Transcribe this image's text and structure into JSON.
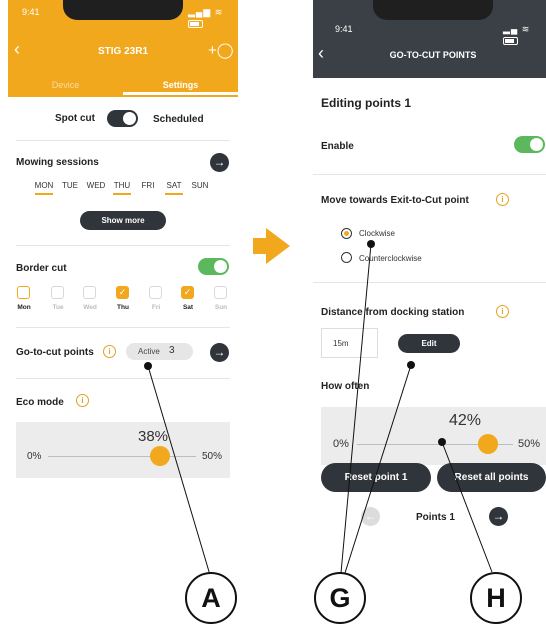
{
  "colors": {
    "accent": "#f2a81d",
    "dark": "#2f353b",
    "toggle_on": "#5cb85c",
    "header_dark": "#3a4046"
  },
  "left": {
    "status_time": "9:41",
    "title": "STIG 23R1",
    "tabs": [
      "Device",
      "Settings"
    ],
    "mode": {
      "left_label": "Spot cut",
      "right_label": "Scheduled"
    },
    "mowing_sessions": {
      "label": "Mowing sessions",
      "days": [
        "MON",
        "TUE",
        "WED",
        "THU",
        "FRI",
        "SAT",
        "SUN"
      ],
      "underlined": [
        true,
        false,
        false,
        true,
        false,
        true,
        false
      ],
      "show_more": "Show more"
    },
    "border_cut": {
      "label": "Border cut",
      "days": [
        "Mon",
        "Tue",
        "Wed",
        "Thu",
        "Fri",
        "Sat",
        "Sun"
      ],
      "checked": [
        "outline",
        "off",
        "off",
        "on",
        "off",
        "on",
        "off"
      ]
    },
    "go_to_cut": {
      "label": "Go-to-cut points",
      "status": "Active",
      "count": "3"
    },
    "eco_mode": {
      "label": "Eco mode",
      "min": "0%",
      "max": "50%",
      "value_text": "38%",
      "value": 0.38
    }
  },
  "right": {
    "status_time": "9:41",
    "title": "GO-TO-CUT POINTS",
    "editing": "Editing points 1",
    "enable": "Enable",
    "move_towards": "Move towards Exit-to-Cut point",
    "options": [
      "Clockwise",
      "Counterclockwise"
    ],
    "distance": {
      "label": "Distance from docking station",
      "value": "15m",
      "edit": "Edit"
    },
    "how_often": {
      "label": "How often",
      "min": "0%",
      "max": "50%",
      "value_text": "42%",
      "value": 0.42
    },
    "reset_point": "Reset point 1",
    "reset_all": "Reset all points",
    "points_label": "Points 1"
  },
  "callouts": [
    "A",
    "G",
    "H"
  ],
  "icons": [
    "back-icon",
    "add-user-icon",
    "info-icon",
    "arrow-right-icon",
    "arrow-left-icon",
    "check-icon"
  ]
}
